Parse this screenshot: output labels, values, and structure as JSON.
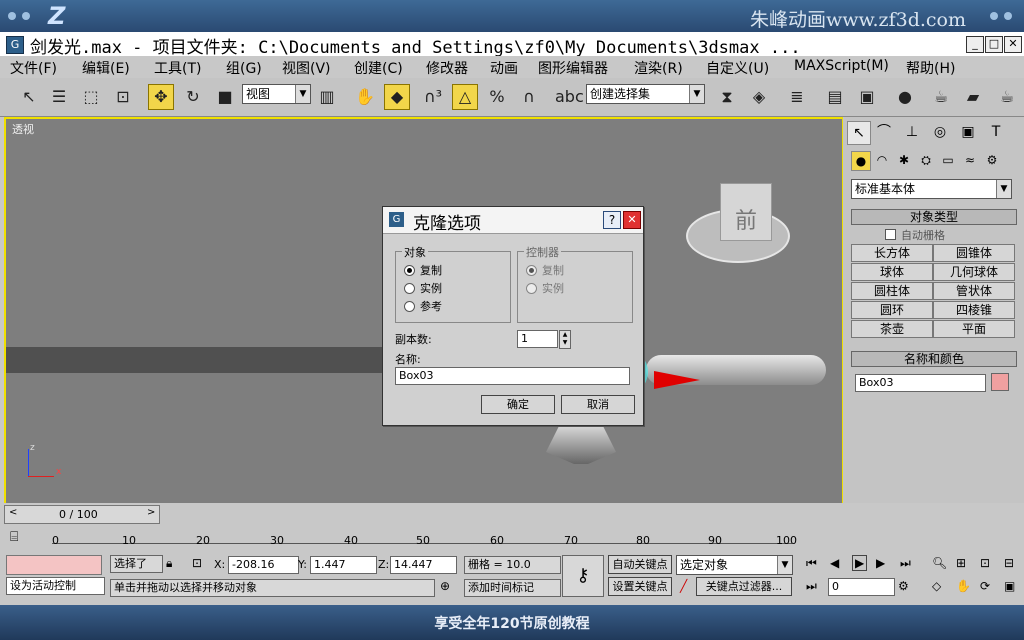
{
  "banner": {
    "logo": "Z",
    "watermark": "朱峰动画www.zf3d.com"
  },
  "window": {
    "title": "剑发光.max     - 项目文件夹: C:\\Documents and Settings\\zf0\\My Documents\\3dsmax   ..."
  },
  "menu": [
    "文件(F)",
    "编辑(E)",
    "工具(T)",
    "组(G)",
    "视图(V)",
    "创建(C)",
    "修改器",
    "动画",
    "图形编辑器",
    "渲染(R)",
    "自定义(U)",
    "MAXScript(M)",
    "帮助(H)"
  ],
  "toolbar": {
    "view_combo": "视图",
    "selection_set": "创建选择集"
  },
  "viewport": {
    "label": "透视",
    "cube_face": "前"
  },
  "dialog": {
    "title": "克隆选项",
    "help": "?",
    "close": "✕",
    "object_group": "对象",
    "object_options": [
      "复制",
      "实例",
      "参考"
    ],
    "controller_group": "控制器",
    "controller_options": [
      "复制",
      "实例"
    ],
    "copies_label": "副本数:",
    "copies_value": "1",
    "name_label": "名称:",
    "name_value": "Box03",
    "ok": "确定",
    "cancel": "取消"
  },
  "panel": {
    "category": "标准基本体",
    "rollout_type": "对象类型",
    "autogrid": "自动栅格",
    "buttons": [
      "长方体",
      "圆锥体",
      "球体",
      "几何球体",
      "圆柱体",
      "管状体",
      "圆环",
      "四棱锥",
      "茶壶",
      "平面"
    ],
    "rollout_name": "名称和颜色",
    "name_value": "Box03",
    "color": "#f0a0a0"
  },
  "timeline": {
    "frame": "0 / 100",
    "ticks": [
      "0",
      "10",
      "20",
      "30",
      "40",
      "50",
      "60",
      "70",
      "80",
      "90",
      "100"
    ]
  },
  "status": {
    "selected": "选择了",
    "x_label": "X:",
    "x": "-208.16",
    "y_label": "Y:",
    "y": "1.447",
    "z_label": "Z:",
    "z": "14.447",
    "grid": "栅格 = 10.0",
    "auto_key": "自动关键点",
    "set_key": "设置关键点",
    "selected_obj": "选定对象",
    "key_filters": "关键点过滤器...",
    "frame_field": "0",
    "activate": "设为活动控制",
    "prompt": "单击并拖动以选择并移动对象",
    "add_time_tag": "添加时间标记"
  },
  "footer": {
    "text": "享受全年120节原创教程"
  }
}
